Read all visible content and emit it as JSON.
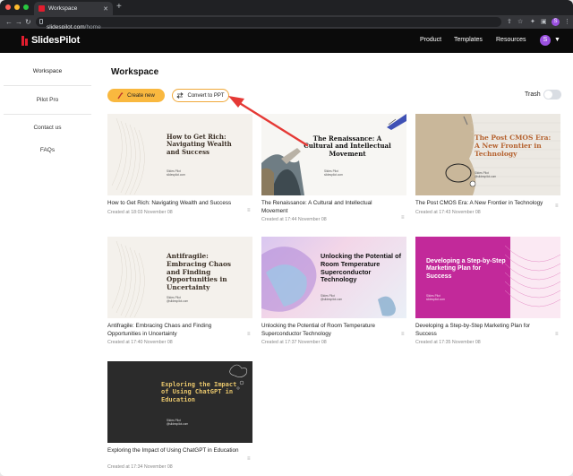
{
  "browser": {
    "tab_title": "Workspace",
    "url_host": "slidespilot.com",
    "url_path": "/home",
    "profile_initial": "S"
  },
  "header": {
    "logo": "SlidesPilot",
    "nav": [
      "Product",
      "Templates",
      "Resources"
    ],
    "avatar_initial": "S"
  },
  "sidebar": {
    "items": [
      {
        "label": "Workspace"
      },
      {
        "label": "Pilot Pro"
      },
      {
        "label": "Contact us"
      },
      {
        "label": "FAQs"
      }
    ]
  },
  "main": {
    "title": "Workspace",
    "create_label": "Create new",
    "convert_label": "Convert to PPT",
    "trash_label": "Trash",
    "trash_on": false
  },
  "cards": [
    {
      "title": "How to Get Rich: Navigating Wealth and Success",
      "meta": "Created at 18:03 November 08",
      "thumb_title": "How to Get Rich: Navigating Wealth and Success",
      "thumb_sub": "Slides Pilot\nslidespilot.com"
    },
    {
      "title": "The Renaissance: A Cultural and Intellectual Movement",
      "meta": "Created at 17:44 November 08",
      "thumb_title": "The Renaissance: A Cultural and Intellectual Movement",
      "thumb_sub": "Slides Pilot\nslidespilot.com"
    },
    {
      "title": "The Post CMOS Era: A New Frontier in Technology",
      "meta": "Created at 17:43 November 08",
      "thumb_title": "The Post CMOS Era: A New Frontier in Technology",
      "thumb_sub": "Slides Pilot\n@slidespilot.com"
    },
    {
      "title": "Antifragile: Embracing Chaos and Finding Opportunities in Uncertainty",
      "meta": "Created at 17:40 November 08",
      "thumb_title": "Antifragile: Embracing Chaos and Finding Opportunities in Uncertainty",
      "thumb_sub": "Slides Pilot\n@slidespilot.com"
    },
    {
      "title": "Unlocking the Potential of Room Temperature Superconductor Technology",
      "meta": "Created at 17:37 November 08",
      "thumb_title": "Unlocking the Potential of Room Temperature Superconductor Technology",
      "thumb_sub": "Slides Pilot\n@slidespilot.com"
    },
    {
      "title": "Developing a Step-by-Step Marketing Plan for Success",
      "meta": "Created at 17:35 November 08",
      "thumb_title": "Developing a Step-by-Step Marketing Plan for Success",
      "thumb_sub": "Slides Pilot\nslidespilot.com"
    },
    {
      "title": "Exploring the Impact of Using ChatGPT in Education",
      "meta": "Created at 17:34 November 08",
      "thumb_title": "Exploring the Impact of Using ChatGPT in Education",
      "thumb_sub": "Slides Pilot\n@slidespilot.com"
    }
  ],
  "colors": {
    "brand_red": "#e11d2e",
    "accent_orange": "#f9b83f",
    "annotation_arrow": "#e53935"
  }
}
